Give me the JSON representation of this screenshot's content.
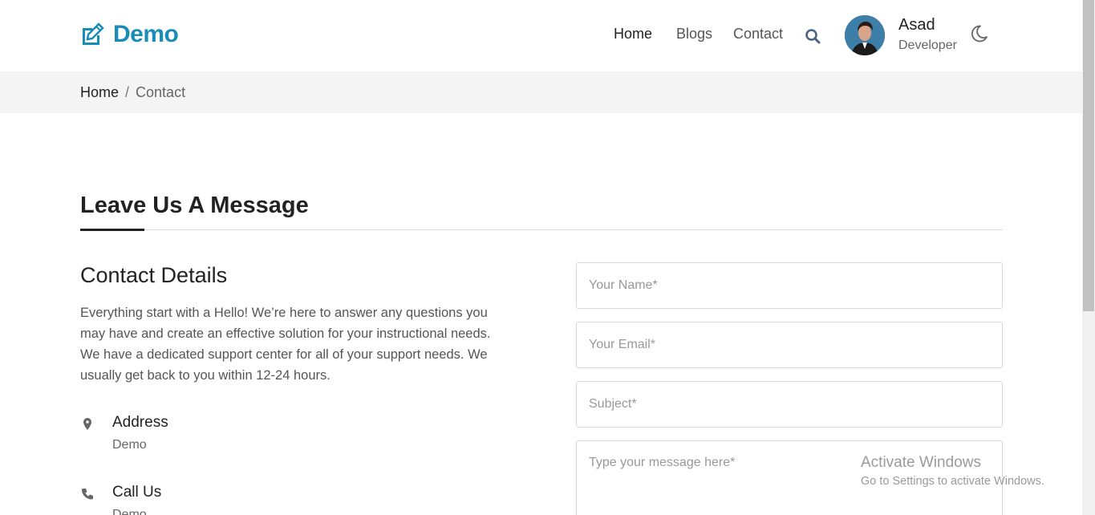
{
  "header": {
    "brand": "Demo",
    "nav": [
      {
        "label": "Home",
        "active": true
      },
      {
        "label": "Blogs",
        "active": false
      },
      {
        "label": "Contact",
        "active": false
      }
    ],
    "user": {
      "name": "Asad",
      "role": "Developer"
    }
  },
  "breadcrumb": {
    "home": "Home",
    "separator": "/",
    "current": "Contact"
  },
  "main": {
    "section_title": "Leave Us A Message",
    "details_title": "Contact Details",
    "details_text": "Everything start with a Hello! We’re here to answer any questions you may have and create an effective solution for your instructional needs. We have a dedicated support center for all of your support needs. We usually get back to you within 12-24 hours.",
    "info": [
      {
        "label": "Address",
        "value": "Demo",
        "icon": "map-marker-icon"
      },
      {
        "label": "Call Us",
        "value": "Demo",
        "icon": "phone-icon"
      }
    ]
  },
  "form": {
    "name_placeholder": "Your Name*",
    "email_placeholder": "Your Email*",
    "subject_placeholder": "Subject*",
    "message_placeholder": "Type your message here*"
  },
  "watermark": {
    "title": "Activate Windows",
    "subtitle": "Go to Settings to activate Windows."
  },
  "colors": {
    "brand": "#1a8cb8",
    "breadcrumb_bg": "#f4f4f4",
    "text_dark": "#222222",
    "text_muted": "#555555"
  }
}
